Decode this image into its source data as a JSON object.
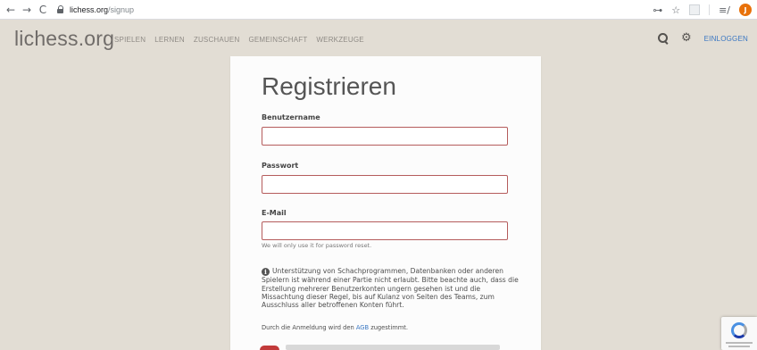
{
  "browser": {
    "back_icon": "←",
    "forward_icon": "→",
    "reload_icon": "C",
    "url_host": "lichess.org",
    "url_path": "/signup",
    "key_icon": "⊶",
    "star_icon": "☆",
    "reading_list_icon": "≡/",
    "profile_initial": "J"
  },
  "header": {
    "logo": "lichess.org",
    "nav": [
      "SPIELEN",
      "LERNEN",
      "ZUSCHAUEN",
      "GEMEINSCHAFT",
      "WERKZEUGE"
    ],
    "signin": "EINLOGGEN"
  },
  "form": {
    "title": "Registrieren",
    "username_label": "Benutzername",
    "username_value": "",
    "password_label": "Passwort",
    "password_value": "",
    "email_label": "E-Mail",
    "email_value": "",
    "email_help": "We will only use it for password reset.",
    "agreement_text": "Unterstützung von Schachprogrammen, Datenbanken oder anderen Spielern ist während einer Partie nicht erlaubt. Bitte beachte auch, dass die Erstellung mehrerer Benutzerkonten ungern gesehen ist und die Missachtung dieser Regel, bis auf Kulanz von Seiten des Teams, zum Ausschluss aller betroffenen Konten führt.",
    "tos_prefix": "Durch die Anmeldung wird den ",
    "tos_link": "AGB",
    "tos_suffix": " zugestimmt."
  },
  "colors": {
    "page_bg": "#e2ddd4",
    "card_bg": "#fcfcfc",
    "input_border": "#b55c5c",
    "link": "#3a77c2",
    "toggle": "#c23a3a"
  }
}
